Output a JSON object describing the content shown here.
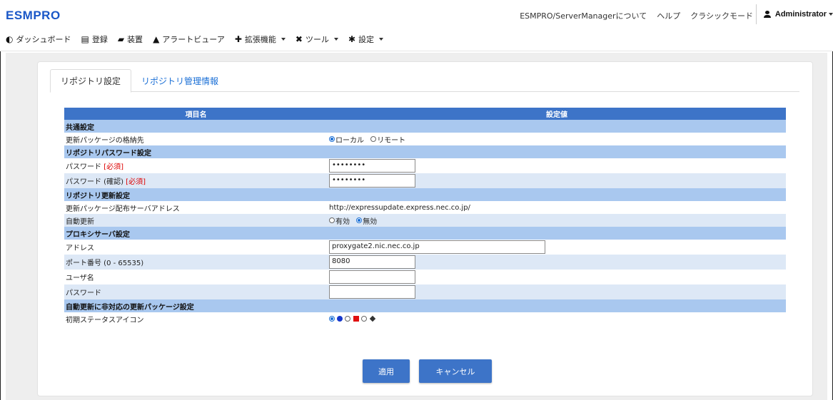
{
  "app": {
    "brand": "ESMPRO"
  },
  "header": {
    "links": [
      "ESMPRO/ServerManagerについて",
      "ヘルプ",
      "クラシックモード"
    ],
    "user": "Administrator"
  },
  "nav": [
    {
      "icon": "dashboard-icon",
      "glyph": "◐",
      "label": "ダッシュボード",
      "dropdown": false
    },
    {
      "icon": "register-icon",
      "glyph": "▤",
      "label": "登録",
      "dropdown": false
    },
    {
      "icon": "device-icon",
      "glyph": "▰",
      "label": "装置",
      "dropdown": false
    },
    {
      "icon": "alert-icon",
      "glyph": "▲",
      "label": "アラートビューア",
      "dropdown": false
    },
    {
      "icon": "plus-icon",
      "glyph": "✚",
      "label": "拡張機能",
      "dropdown": true
    },
    {
      "icon": "tools-icon",
      "glyph": "✖",
      "label": "ツール",
      "dropdown": true
    },
    {
      "icon": "gear-icon",
      "glyph": "✱",
      "label": "設定",
      "dropdown": true
    }
  ],
  "tabs": {
    "active": "リポジトリ設定",
    "inactive": "リポジトリ管理情報"
  },
  "table": {
    "col_item": "項目名",
    "col_value": "設定値",
    "common": {
      "section": "共通設定",
      "storage_label": "更新パッケージの格納先",
      "storage_local": "ローカル",
      "storage_remote": "リモート"
    },
    "password": {
      "section": "リポジトリパスワード設定",
      "password_label": "パスワード",
      "confirm_label": "パスワード (確認)",
      "required": "[必須]",
      "password_value": "••••••••",
      "confirm_value": "••••••••"
    },
    "update": {
      "section": "リポジトリ更新設定",
      "server_label": "更新パッケージ配布サーバアドレス",
      "server_value": "http://expressupdate.express.nec.co.jp/",
      "auto_label": "自動更新",
      "auto_enabled": "有効",
      "auto_disabled": "無効"
    },
    "proxy": {
      "section": "プロキシサーバ設定",
      "address_label": "アドレス",
      "address_value": "proxygate2.nic.nec.co.jp",
      "port_label": "ポート番号 (0 - 65535)",
      "port_value": "8080",
      "user_label": "ユーザ名",
      "user_value": "",
      "pass_label": "パスワード",
      "pass_value": ""
    },
    "nonauto": {
      "section": "自動更新に非対応の更新パッケージ設定",
      "icon_label": "初期ステータスアイコン"
    }
  },
  "buttons": {
    "apply": "適用",
    "cancel": "キャンセル"
  },
  "colors": {
    "brand": "#1a57c7",
    "header_blue": "#3d74c8",
    "section_blue": "#a9c8ef",
    "row_alt": "#dde8f6",
    "required": "#dd0000"
  }
}
